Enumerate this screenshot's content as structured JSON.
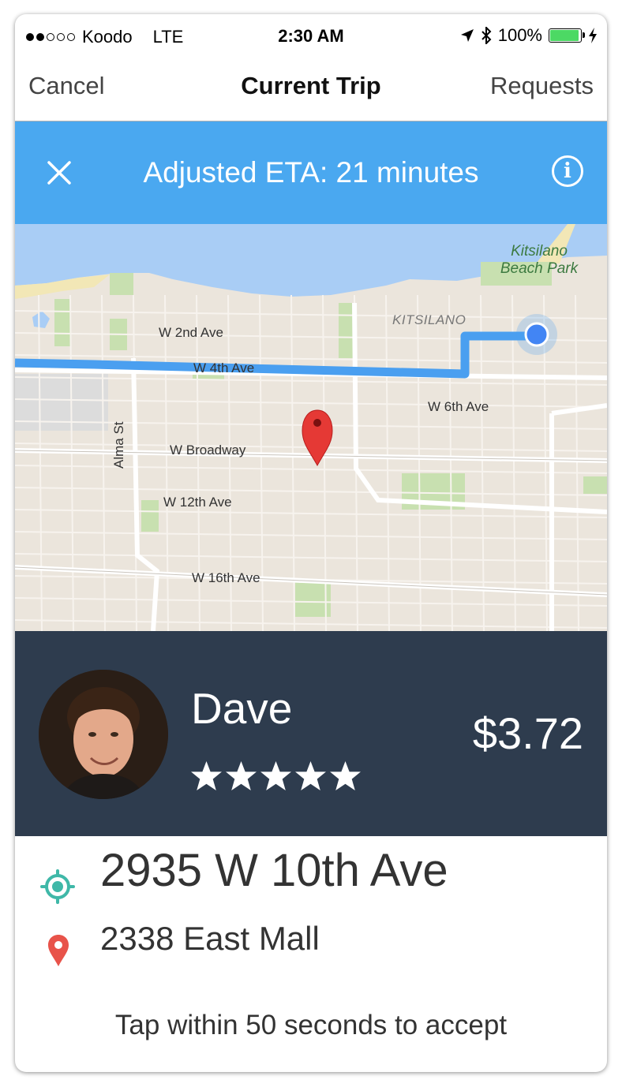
{
  "status_bar": {
    "carrier": "Koodo",
    "network": "LTE",
    "time": "2:30 AM",
    "battery": "100%",
    "battery_level": 1.0,
    "signal_bars_filled": 2,
    "signal_bars_total": 5,
    "icons": [
      "location-arrow-icon",
      "bluetooth-icon",
      "battery-icon",
      "charging-icon"
    ]
  },
  "nav": {
    "left": "Cancel",
    "title": "Current Trip",
    "right": "Requests"
  },
  "eta_banner": {
    "text": "Adjusted ETA: 21 minutes",
    "close_icon": "close-icon",
    "info_glyph": "i",
    "color": "#4aa8f0"
  },
  "map": {
    "labels": {
      "park": "Kitsilano Beach Park",
      "neighborhood": "KITSILANO",
      "w2": "W 2nd Ave",
      "w4": "W 4th Ave",
      "w6": "W 6th Ave",
      "alma": "Alma St",
      "broadway": "W Broadway",
      "w12": "W 12th Ave",
      "w16": "W 16th Ave"
    },
    "route_color": "#4a9ff0",
    "pin_color": "#e53935"
  },
  "driver": {
    "name": "Dave",
    "rating": 5,
    "rating_max": 5,
    "fare": "$3.72",
    "panel_color": "#2e3c4e"
  },
  "trip": {
    "pickup": "2935 W 10th Ave",
    "dropoff": "2338 East Mall",
    "pickup_icon_color": "#3fb8a8",
    "dropoff_icon_color": "#e8534a"
  },
  "hint": "Tap within 50 seconds to accept"
}
